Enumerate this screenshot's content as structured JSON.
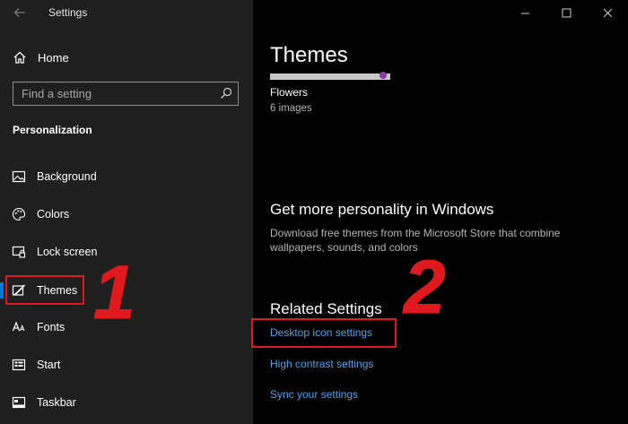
{
  "window": {
    "title": "Settings",
    "minimize": "minimize-icon",
    "maximize": "maximize-icon",
    "close": "close-icon"
  },
  "sidebar": {
    "home_label": "Home",
    "search_placeholder": "Find a setting",
    "section_title": "Personalization",
    "items": [
      {
        "label": "Background",
        "icon": "picture-icon"
      },
      {
        "label": "Colors",
        "icon": "palette-icon"
      },
      {
        "label": "Lock screen",
        "icon": "lock-screen-icon"
      },
      {
        "label": "Themes",
        "icon": "themes-icon",
        "active": true
      },
      {
        "label": "Fonts",
        "icon": "fonts-icon"
      },
      {
        "label": "Start",
        "icon": "start-icon"
      },
      {
        "label": "Taskbar",
        "icon": "taskbar-icon"
      }
    ]
  },
  "main": {
    "page_title": "Themes",
    "current_theme": {
      "name": "Flowers",
      "count": "6 images"
    },
    "personality": {
      "heading": "Get more personality in Windows",
      "description": "Download free themes from the Microsoft Store that combine wallpapers, sounds, and colors"
    },
    "related": {
      "heading": "Related Settings",
      "links": [
        "Desktop icon settings",
        "High contrast settings",
        "Sync your settings"
      ]
    }
  },
  "annotations": {
    "step1": "1",
    "step2": "2"
  },
  "colors": {
    "accent": "#0078d7",
    "link": "#4aa4ee",
    "annotation": "#e0191d"
  }
}
